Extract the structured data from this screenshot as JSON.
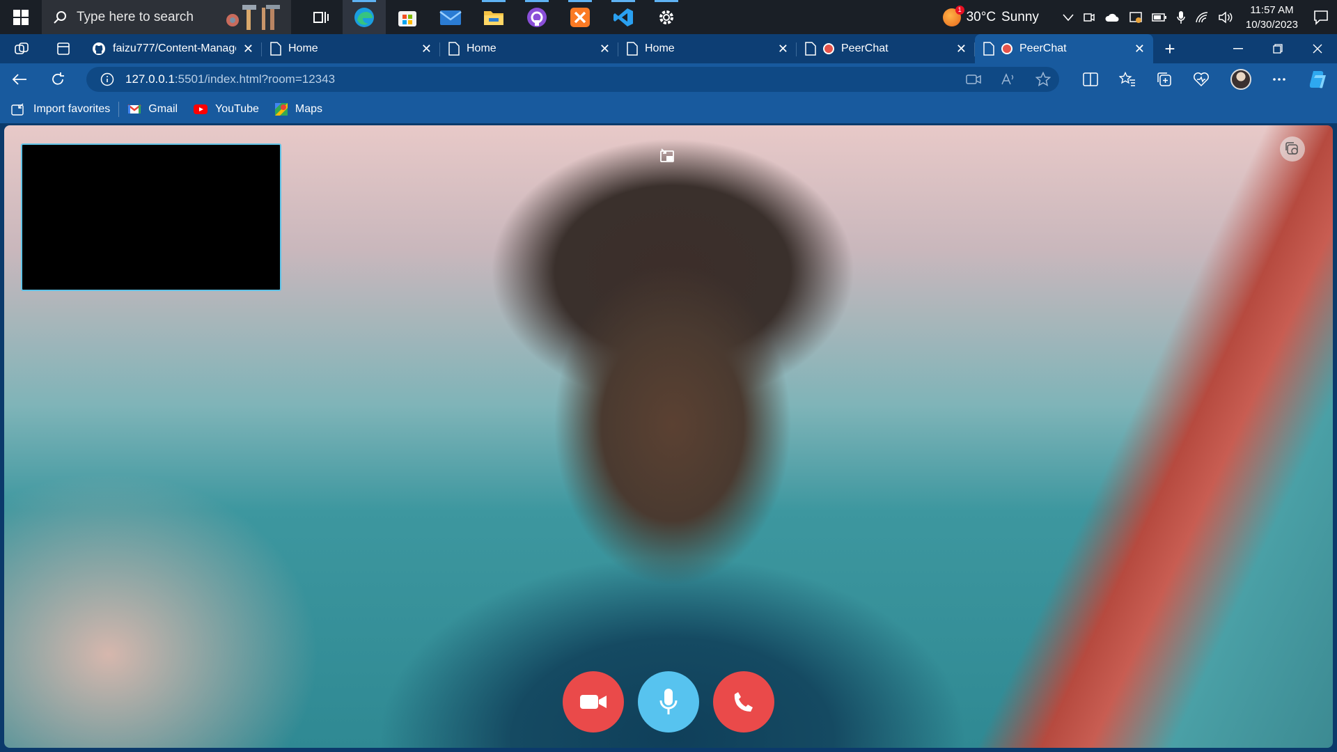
{
  "taskbar": {
    "search_placeholder": "Type here to search",
    "weather": {
      "temp": "30°C",
      "condition": "Sunny",
      "badge": "1"
    },
    "clock": {
      "time": "11:57 AM",
      "date": "10/30/2023"
    },
    "apps": [
      "task-view",
      "edge",
      "microsoft-store",
      "mail",
      "file-explorer",
      "github-desktop",
      "xampp",
      "vscode",
      "settings"
    ]
  },
  "browser": {
    "tabs": [
      {
        "title": "faizu777/Content-Manage",
        "icon": "github-icon"
      },
      {
        "title": "Home",
        "icon": "page-icon"
      },
      {
        "title": "Home",
        "icon": "page-icon"
      },
      {
        "title": "Home",
        "icon": "page-icon"
      },
      {
        "title": "PeerChat",
        "icon": "page-icon"
      },
      {
        "title": "PeerChat",
        "icon": "page-icon",
        "active": true
      }
    ],
    "address": {
      "host": "127.0.0.1",
      "path": ":5501/index.html?room=12343"
    },
    "favorites": [
      {
        "label": "Import favorites",
        "icon": "import-icon"
      },
      {
        "label": "Gmail",
        "icon": "gmail-icon"
      },
      {
        "label": "YouTube",
        "icon": "youtube-icon"
      },
      {
        "label": "Maps",
        "icon": "maps-icon"
      }
    ]
  },
  "page": {
    "colors": {
      "camera_button": "#ea4a4a",
      "mic_button": "#57c3ef",
      "hangup_button": "#ea4a4a",
      "self_view_border": "#62c4e8"
    }
  }
}
